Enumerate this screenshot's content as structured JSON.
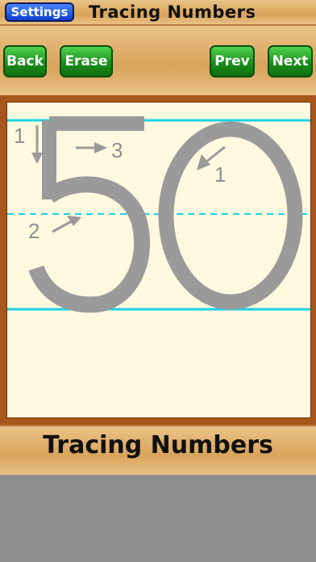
{
  "header": {
    "settings_label": "Settings",
    "title": "Tracing Numbers"
  },
  "toolbar": {
    "back_label": "Back",
    "erase_label": "Erase",
    "prev_label": "Prev",
    "next_label": "Next"
  },
  "worksheet": {
    "number": "50",
    "stroke_labels": [
      "1",
      "2",
      "3",
      "1"
    ],
    "guide_color": "#19d3e6",
    "digit_color": "#9a9a9a"
  },
  "footer": {
    "title": "Tracing Numbers"
  }
}
